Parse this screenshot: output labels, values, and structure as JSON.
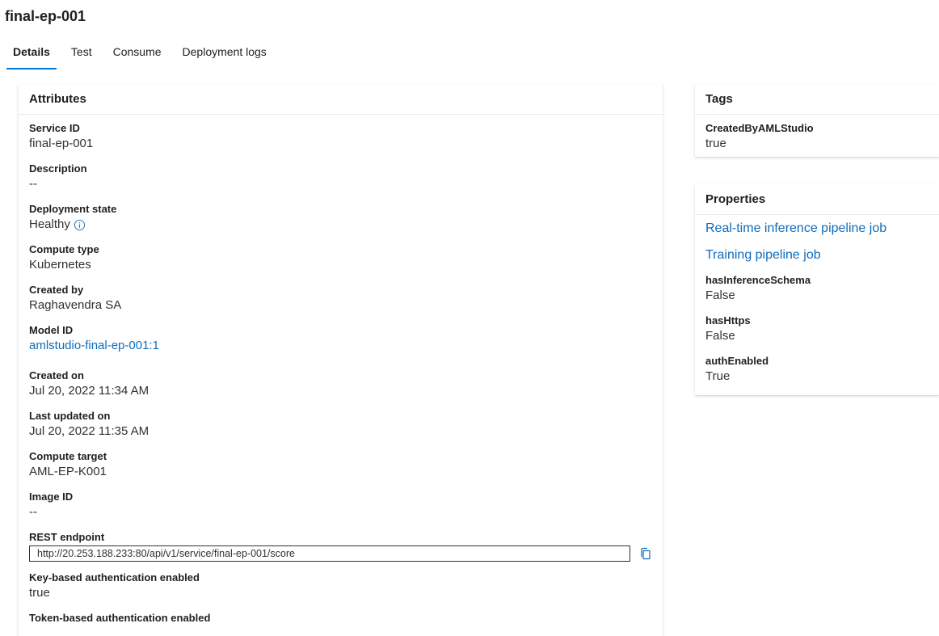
{
  "page": {
    "title": "final-ep-001"
  },
  "tabs": [
    {
      "label": "Details",
      "active": true
    },
    {
      "label": "Test",
      "active": false
    },
    {
      "label": "Consume",
      "active": false
    },
    {
      "label": "Deployment logs",
      "active": false
    }
  ],
  "attributes": {
    "header": "Attributes",
    "service_id": {
      "label": "Service ID",
      "value": "final-ep-001"
    },
    "description": {
      "label": "Description",
      "value": "--"
    },
    "deployment_state": {
      "label": "Deployment state",
      "value": "Healthy",
      "icon": "info-icon"
    },
    "compute_type": {
      "label": "Compute type",
      "value": "Kubernetes"
    },
    "created_by": {
      "label": "Created by",
      "value": "Raghavendra SA"
    },
    "model_id": {
      "label": "Model ID",
      "value": "amlstudio-final-ep-001:1"
    },
    "created_on": {
      "label": "Created on",
      "value": "Jul 20, 2022 11:34 AM"
    },
    "last_updated_on": {
      "label": "Last updated on",
      "value": "Jul 20, 2022 11:35 AM"
    },
    "compute_target": {
      "label": "Compute target",
      "value": "AML-EP-K001"
    },
    "image_id": {
      "label": "Image ID",
      "value": "--"
    },
    "rest_endpoint": {
      "label": "REST endpoint",
      "value": "http://20.253.188.233:80/api/v1/service/final-ep-001/score",
      "icon": "copy-icon"
    },
    "key_auth": {
      "label": "Key-based authentication enabled",
      "value": "true"
    },
    "token_auth": {
      "label": "Token-based authentication enabled"
    }
  },
  "tags": {
    "header": "Tags",
    "items": [
      {
        "label": "CreatedByAMLStudio",
        "value": "true"
      }
    ]
  },
  "properties": {
    "header": "Properties",
    "links": [
      "Real-time inference pipeline job",
      "Training pipeline job"
    ],
    "items": [
      {
        "label": "hasInferenceSchema",
        "value": "False"
      },
      {
        "label": "hasHttps",
        "value": "False"
      },
      {
        "label": "authEnabled",
        "value": "True"
      }
    ]
  },
  "colors": {
    "accent": "#0078d4",
    "link": "#0f6cbd",
    "text": "#201f1e"
  }
}
